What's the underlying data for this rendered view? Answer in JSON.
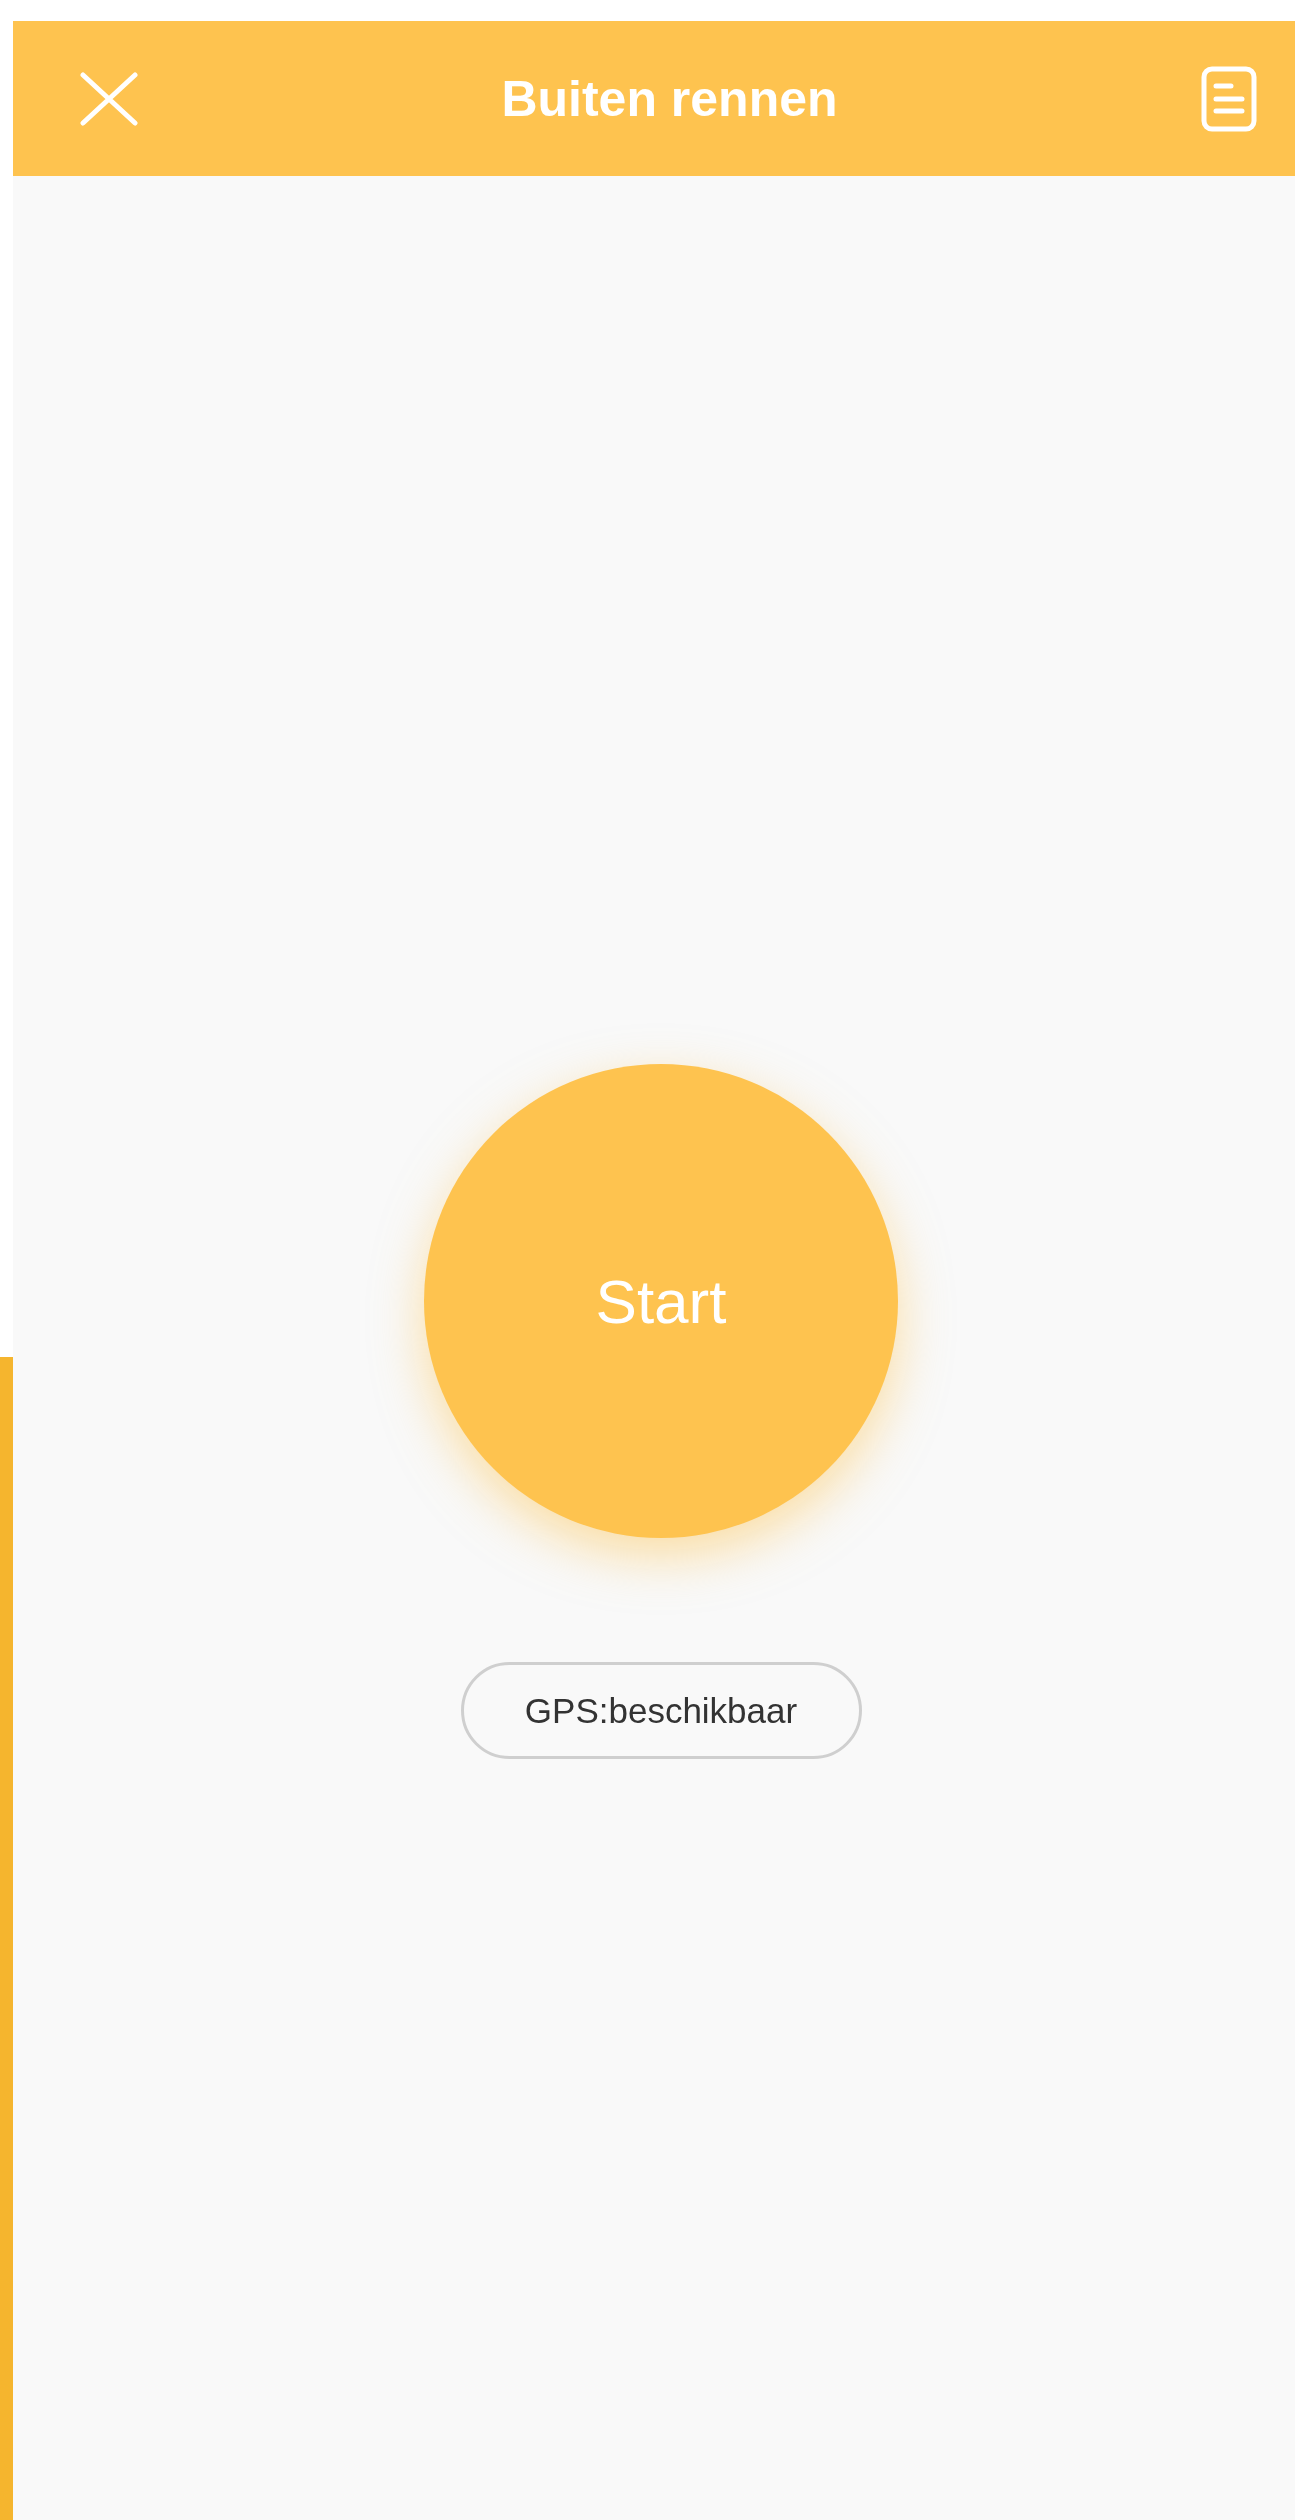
{
  "header": {
    "title": "Buiten rennen"
  },
  "start_button": {
    "label": "Start"
  },
  "gps_status": {
    "text": "GPS:beschikbaar"
  }
}
